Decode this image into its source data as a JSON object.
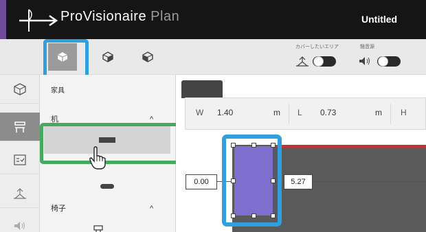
{
  "app": {
    "brand_main": "ProVisionaire",
    "brand_sub": "Plan",
    "document_title": "Untitled",
    "accent_color": "#6e4c9a"
  },
  "toolbar": {
    "view_buttons": [
      {
        "icon": "cube-top-icon",
        "active": true
      },
      {
        "icon": "cube-front-icon",
        "active": false
      },
      {
        "icon": "cube-side-icon",
        "active": false
      }
    ],
    "coverage_label": "カバーしたいエリア",
    "noise_label": "騒音源",
    "coverage_toggle": "off",
    "noise_toggle": "off"
  },
  "rail": {
    "items": [
      {
        "icon": "room-icon",
        "active": false
      },
      {
        "icon": "furniture-icon",
        "active": true
      },
      {
        "icon": "checklist-icon",
        "active": false
      },
      {
        "icon": "coverage-area-icon",
        "active": false
      },
      {
        "icon": "speaker-icon",
        "active": false
      }
    ]
  },
  "panel": {
    "header": "家具",
    "sections": [
      {
        "title": "机",
        "expanded": true
      },
      {
        "title": "椅子",
        "expanded": true
      }
    ],
    "caret_symbol": "^"
  },
  "dimensions": {
    "w_label": "W",
    "w_value": "1.40",
    "w_unit": "m",
    "l_label": "L",
    "l_value": "0.73",
    "l_unit": "m",
    "h_label": "H"
  },
  "canvas": {
    "x_offset": "0.00",
    "distance": "5.27",
    "furniture_color": "#7e6fce",
    "highlight_color": "#2f9fe0",
    "selection_color": "#47a95f"
  }
}
